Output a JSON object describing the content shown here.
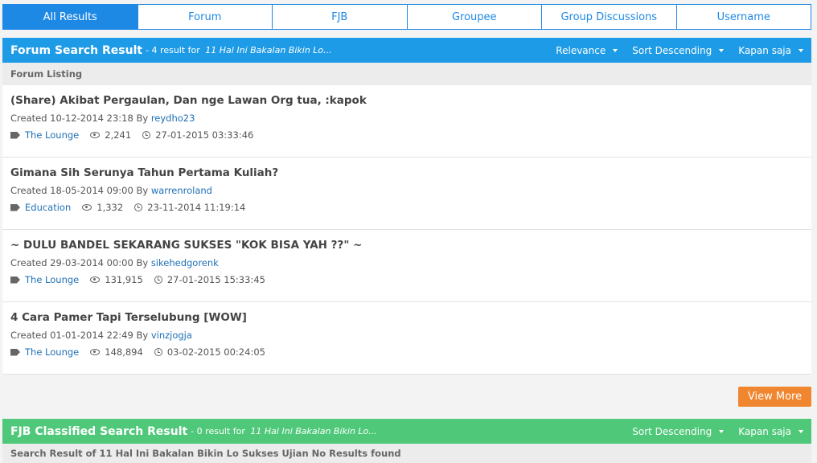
{
  "tabs": [
    {
      "label": "All Results",
      "active": true
    },
    {
      "label": "Forum"
    },
    {
      "label": "FJB"
    },
    {
      "label": "Groupee"
    },
    {
      "label": "Group Discussions"
    },
    {
      "label": "Username"
    }
  ],
  "forum": {
    "title": "Forum Search Result",
    "summary_prefix": "- 4 result for",
    "query": "11 Hal Ini Bakalan Bikin Lo...",
    "sort_relevance": "Relevance",
    "sort_order": "Sort Descending",
    "time_filter": "Kapan saja",
    "listing_label": "Forum Listing",
    "items": [
      {
        "title": "(Share) Akibat Pergaulan, Dan nge Lawan Org tua, :kapok",
        "created": "Created 10-12-2014 23:18 By",
        "author": "reydho23",
        "category": "The Lounge",
        "views": "2,241",
        "last": "27-01-2015 03:33:46"
      },
      {
        "title": "Gimana Sih Serunya Tahun Pertama Kuliah?",
        "created": "Created 18-05-2014 09:00 By",
        "author": "warrenroland",
        "category": "Education",
        "views": "1,332",
        "last": "23-11-2014 11:19:14"
      },
      {
        "title": "~ DULU BANDEL SEKARANG SUKSES \"KOK BISA YAH ??\" ~",
        "created": "Created 29-03-2014 00:00 By",
        "author": "sikehedgorenk",
        "category": "The Lounge",
        "views": "131,915",
        "last": "27-01-2015 15:33:45"
      },
      {
        "title": "4 Cara Pamer Tapi Terselubung [WOW]",
        "created": "Created 01-01-2014 22:49 By",
        "author": "vinzjogja",
        "category": "The Lounge",
        "views": "148,894",
        "last": "03-02-2015 00:24:05"
      }
    ],
    "view_more": "View More"
  },
  "fjb": {
    "title": "FJB Classified Search Result",
    "summary_prefix": "- 0 result for",
    "query": "11 Hal Ini Bakalan Bikin Lo...",
    "sort_order": "Sort Descending",
    "time_filter": "Kapan saja",
    "no_results": "Search Result of 11 Hal Ini Bakalan Bikin Lo Sukses Ujian No Results found"
  },
  "colors": {
    "accent_blue": "#1e9be6",
    "accent_green": "#4fc879",
    "accent_orange": "#f0862f"
  }
}
